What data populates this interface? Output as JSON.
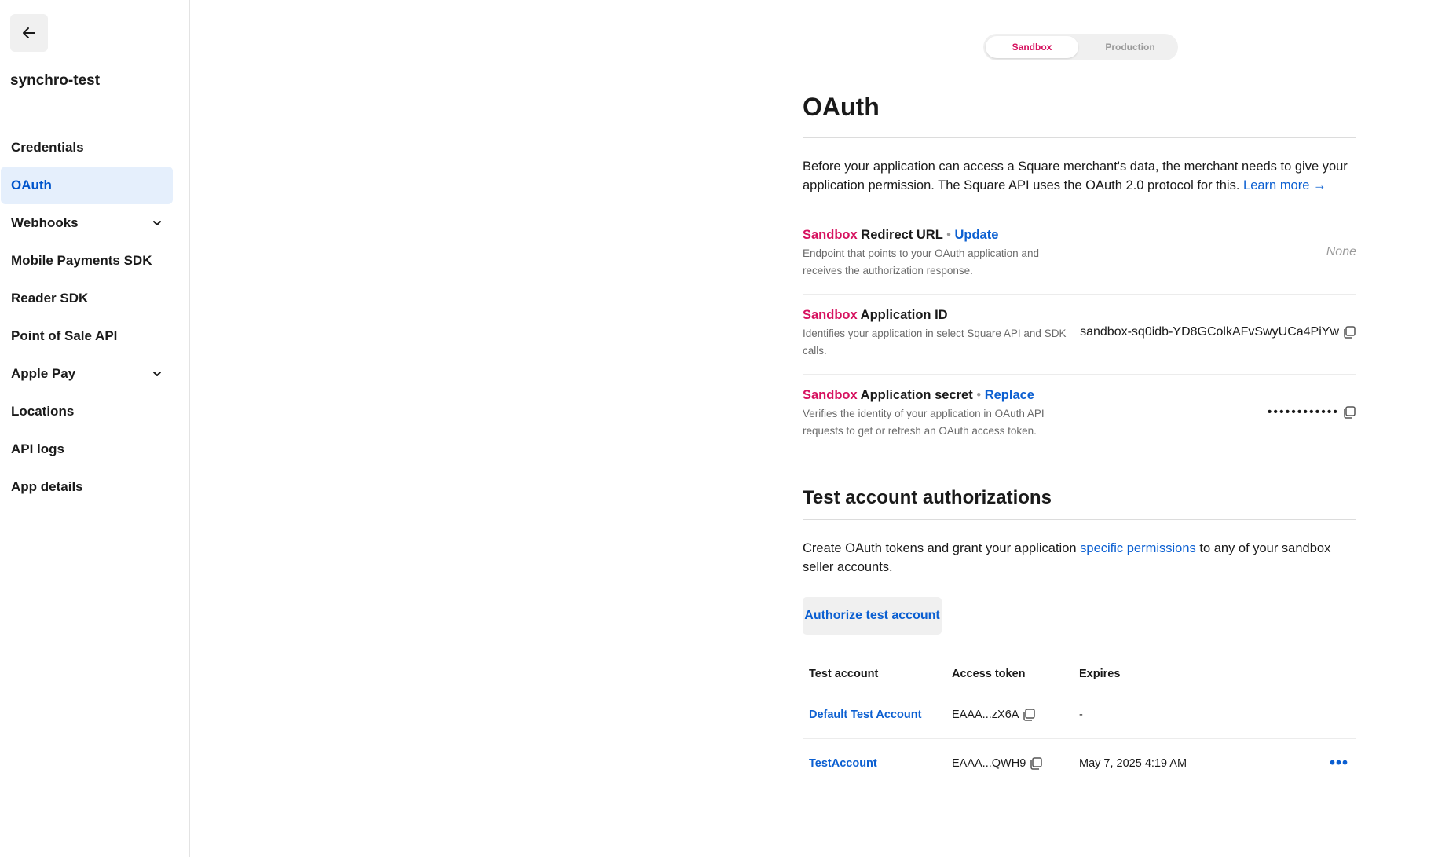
{
  "sidebar": {
    "app_name": "synchro-test",
    "items": [
      {
        "label": "Credentials"
      },
      {
        "label": "OAuth"
      },
      {
        "label": "Webhooks"
      },
      {
        "label": "Mobile Payments SDK"
      },
      {
        "label": "Reader SDK"
      },
      {
        "label": "Point of Sale API"
      },
      {
        "label": "Apple Pay"
      },
      {
        "label": "Locations"
      },
      {
        "label": "API logs"
      },
      {
        "label": "App details"
      }
    ]
  },
  "env_toggle": {
    "sandbox": "Sandbox",
    "production": "Production",
    "selected": "Sandbox"
  },
  "page": {
    "title": "OAuth",
    "intro_text": "Before your application can access a Square merchant's data, the merchant needs to give your application permission. The Square API uses the OAuth 2.0 protocol for this.",
    "learn_more": "Learn more →"
  },
  "fields": {
    "redirect": {
      "env": "Sandbox",
      "label": "Redirect URL",
      "action": "Update",
      "desc": "Endpoint that points to your OAuth application and receives the authorization response.",
      "value": "None"
    },
    "app_id": {
      "env": "Sandbox",
      "label": "Application ID",
      "desc": "Identifies your application in select Square API and SDK calls.",
      "value": "sandbox-sq0idb-YD8GColkAFvSwyUCa4PiYw"
    },
    "secret": {
      "env": "Sandbox",
      "label": "Application secret",
      "action": "Replace",
      "desc": "Verifies the identity of your application in OAuth API requests to get or refresh an OAuth access token.",
      "value": "••••••••••••"
    },
    "separator": "•"
  },
  "test_accounts": {
    "title": "Test account authorizations",
    "intro_before": "Create OAuth tokens and grant your application",
    "intro_link": "specific permissions",
    "intro_after": "to any of your sandbox seller accounts.",
    "button": "Authorize test account",
    "columns": [
      "Test account",
      "Access token",
      "Expires"
    ],
    "rows": [
      {
        "account": "Default Test Account",
        "token": "EAAA...zX6A",
        "expires": "-"
      },
      {
        "account": "TestAccount",
        "token": "EAAA...QWH9",
        "expires": "May 7, 2025 4:19 AM",
        "more": "•••"
      }
    ]
  },
  "colors": {
    "accent": "#0b5fd1",
    "sandbox": "#d6125f",
    "active_nav_bg": "#e5effc"
  }
}
